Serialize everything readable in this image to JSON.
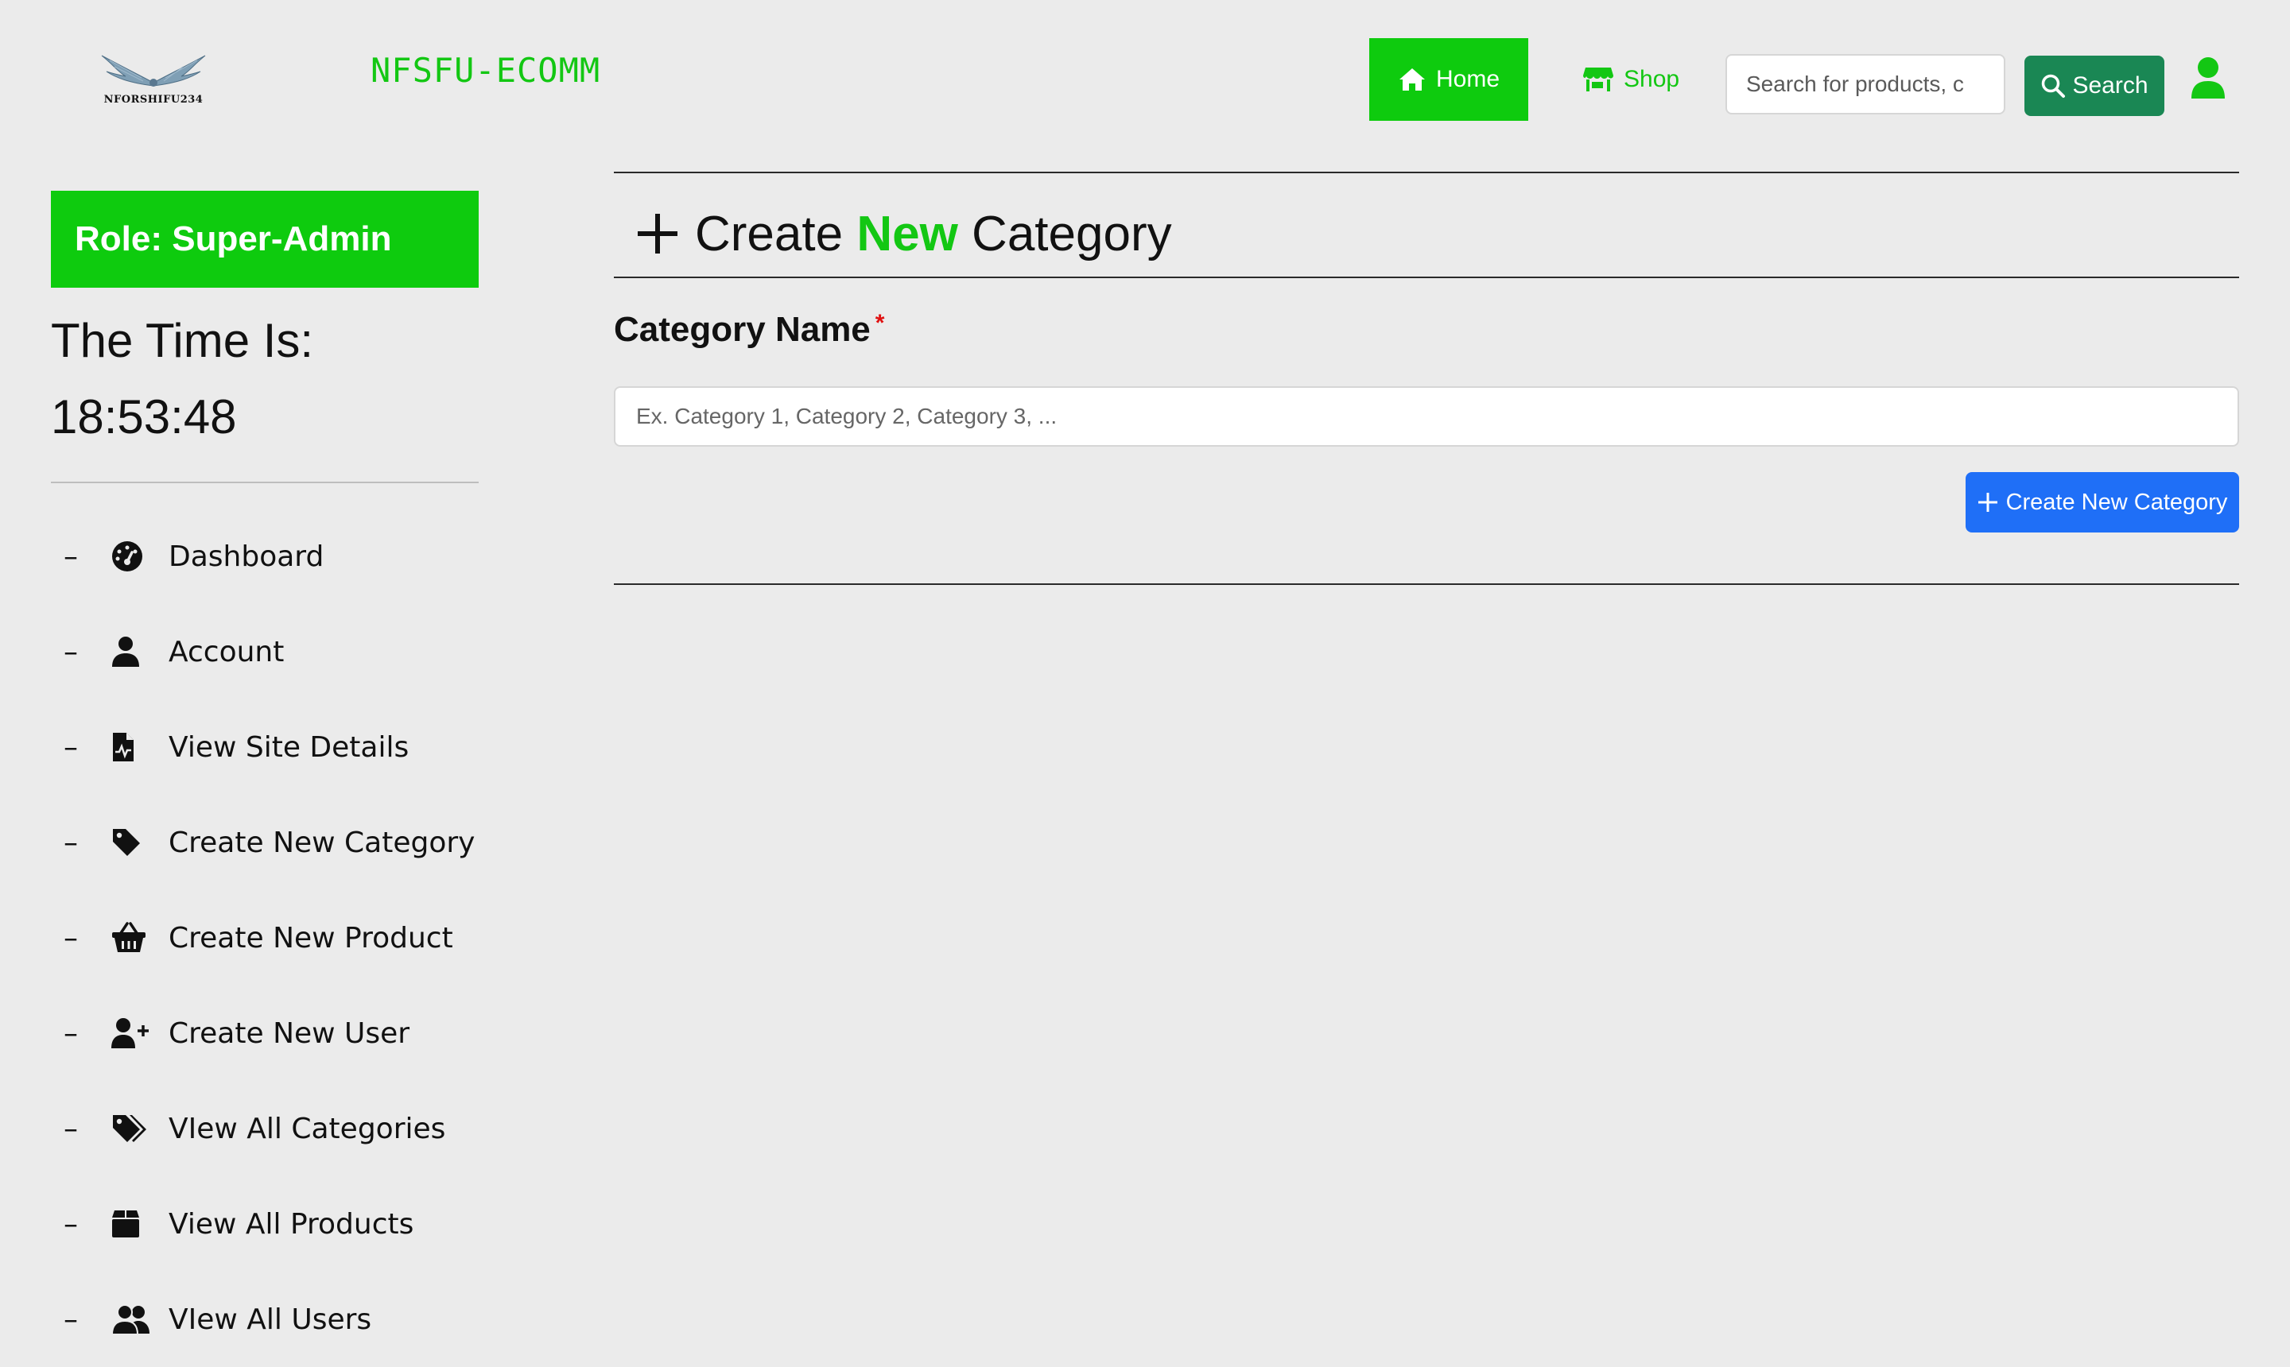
{
  "header": {
    "logo_text": "NFORSHIFU234",
    "brand": "NFSFU-ECOMM",
    "nav": {
      "home_label": "Home",
      "shop_label": "Shop"
    },
    "search": {
      "placeholder": "Search for products, c",
      "button_label": "Search"
    }
  },
  "sidebar": {
    "role": "Role: Super-Admin",
    "time_label": "The Time Is:",
    "time_value": "18:53:48",
    "items": [
      {
        "label": "Dashboard",
        "icon": "dashboard-gauge-icon"
      },
      {
        "label": "Account",
        "icon": "user-icon"
      },
      {
        "label": "View Site Details",
        "icon": "file-waveform-icon"
      },
      {
        "label": "Create New Category",
        "icon": "tag-icon"
      },
      {
        "label": "Create New Product",
        "icon": "basket-icon"
      },
      {
        "label": "Create New User",
        "icon": "user-plus-icon"
      },
      {
        "label": "VIew All Categories",
        "icon": "tags-icon"
      },
      {
        "label": "View All Products",
        "icon": "box-icon"
      },
      {
        "label": "VIew All Users",
        "icon": "users-icon"
      }
    ]
  },
  "main": {
    "title_prefix": "Create",
    "title_accent": "New",
    "title_suffix": "Category",
    "field_label": "Category Name",
    "required_mark": "*",
    "input_placeholder": "Ex. Category 1, Category 2, Category 3, ...",
    "submit_label": "Create New Category"
  },
  "colors": {
    "accent_green": "#0ecb0e",
    "search_button": "#1a8754",
    "primary_blue": "#1f6ff7",
    "required_red": "#e01010",
    "background": "#ebebeb"
  }
}
